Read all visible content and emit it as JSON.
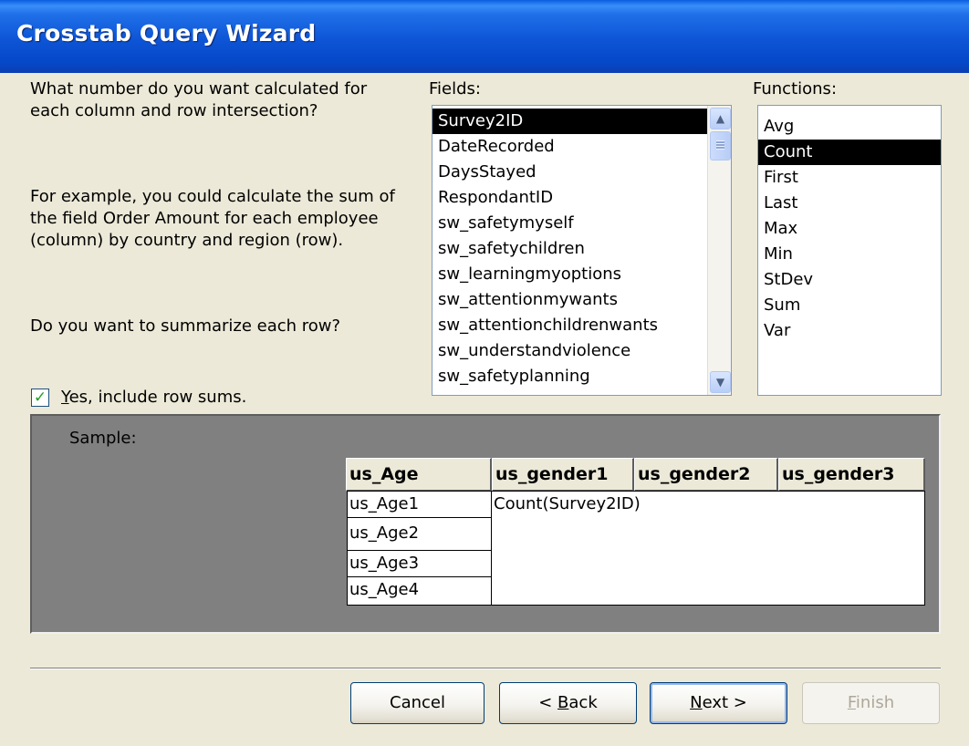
{
  "window": {
    "title": "Crosstab Query Wizard"
  },
  "instructions": {
    "question": "What number do you want calculated for each column and row intersection?",
    "example": "For example, you could calculate the sum of the field Order Amount for each employee (column)  by country and region (row).",
    "summarize_question": "Do you want to summarize each row?"
  },
  "row_sums": {
    "checked": true,
    "label": "Yes, include row sums."
  },
  "fields": {
    "label": "Fields:",
    "items": [
      "Survey2ID",
      "DateRecorded",
      "DaysStayed",
      "RespondantID",
      "sw_safetymyself",
      "sw_safetychildren",
      "sw_learningmyoptions",
      "sw_attentionmywants",
      "sw_attentionchildrenwants",
      "sw_understandviolence",
      "sw_safetyplanning"
    ],
    "selected": "Survey2ID"
  },
  "functions": {
    "label": "Functions:",
    "items": [
      "Avg",
      "Count",
      "First",
      "Last",
      "Max",
      "Min",
      "StDev",
      "Sum",
      "Var"
    ],
    "selected": "Count"
  },
  "sample": {
    "label": "Sample:",
    "row_header": "us_Age",
    "column_headers": [
      "us_gender1",
      "us_gender2",
      "us_gender3"
    ],
    "rows": [
      "us_Age1",
      "us_Age2",
      "us_Age3",
      "us_Age4"
    ],
    "value": "Count(Survey2ID)"
  },
  "buttons": {
    "cancel": "Cancel",
    "back": "< Back",
    "next": "Next >",
    "finish": "Finish"
  }
}
